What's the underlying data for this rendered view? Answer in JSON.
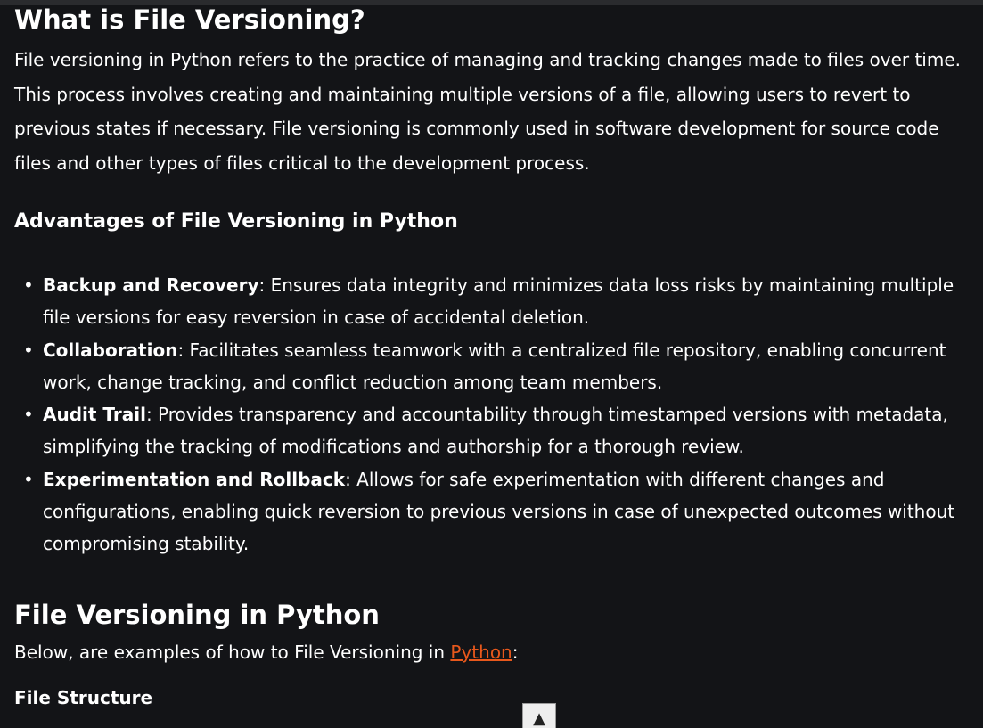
{
  "article": {
    "heading_1": "What is File Versioning?",
    "intro": "File versioning in Python refers to the practice of managing and tracking changes made to files over time. This process involves creating and maintaining multiple versions of a file, allowing users to revert to previous states if necessary. File versioning is commonly used in software development for source code files and other types of files critical to the development process.",
    "advantages_heading": "Advantages of File Versioning in Python",
    "advantages": [
      {
        "term": "Backup and Recovery",
        "desc": ": Ensures data integrity and minimizes data loss risks by maintaining multiple file versions for easy reversion in case of accidental deletion."
      },
      {
        "term": "Collaboration",
        "desc": ": Facilitates seamless teamwork with a centralized file repository, enabling concurrent work, change tracking, and conflict reduction among team members."
      },
      {
        "term": "Audit Trail",
        "desc": ": Provides transparency and accountability through timestamped versions with metadata, simplifying the tracking of modifications and authorship for a thorough review."
      },
      {
        "term": "Experimentation and Rollback",
        "desc": ": Allows for safe experimentation with different changes and configurations, enabling quick reversion to previous versions in case of unexpected outcomes without compromising stability."
      }
    ],
    "heading_2": "File Versioning in Python",
    "below_prefix": "Below, are examples of how to File Versioning in ",
    "below_link": "Python",
    "below_suffix": ":",
    "file_structure": "File Structure"
  },
  "bullet_glyph": "•",
  "scroll_top_glyph": "▲",
  "colors": {
    "background": "#131417",
    "text": "#ffffff",
    "link": "#e8581c"
  }
}
